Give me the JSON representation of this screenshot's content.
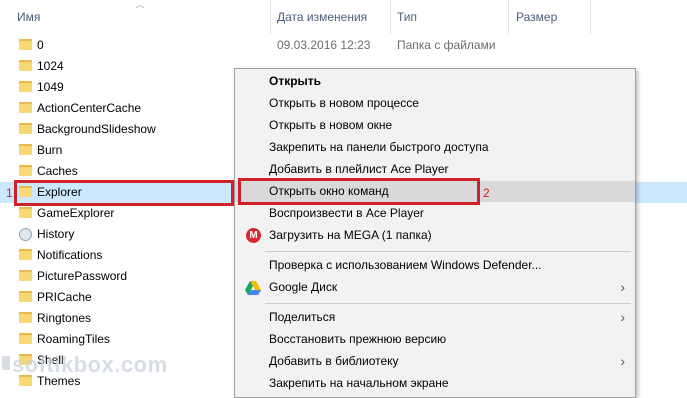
{
  "header": {
    "name": "Имя",
    "date": "Дата изменения",
    "type": "Тип",
    "size": "Размер"
  },
  "rows": [
    {
      "name": "0",
      "date": "09.03.2016 12:23",
      "type": "Папка с файлами"
    },
    {
      "name": "1024",
      "date": "",
      "type": ""
    },
    {
      "name": "1049",
      "date": "",
      "type": ""
    },
    {
      "name": "ActionCenterCache",
      "date": "",
      "type": ""
    },
    {
      "name": "BackgroundSlideshow",
      "date": "",
      "type": ""
    },
    {
      "name": "Burn",
      "date": "",
      "type": ""
    },
    {
      "name": "Caches",
      "date": "",
      "type": ""
    },
    {
      "name": "Explorer",
      "date": "",
      "type": ""
    },
    {
      "name": "GameExplorer",
      "date": "",
      "type": ""
    },
    {
      "name": "History",
      "date": "",
      "type": ""
    },
    {
      "name": "Notifications",
      "date": "",
      "type": ""
    },
    {
      "name": "PicturePassword",
      "date": "",
      "type": ""
    },
    {
      "name": "PRICache",
      "date": "",
      "type": ""
    },
    {
      "name": "Ringtones",
      "date": "",
      "type": ""
    },
    {
      "name": "RoamingTiles",
      "date": "",
      "type": ""
    },
    {
      "name": "Shell",
      "date": "",
      "type": ""
    },
    {
      "name": "Themes",
      "date": "",
      "type": ""
    }
  ],
  "annotations": {
    "one": "1",
    "two": "2",
    "color": "#d0212b"
  },
  "menu": {
    "open": "Открыть",
    "open_new_process": "Открыть в новом процессе",
    "open_new_window": "Открыть в новом окне",
    "pin_quick_access": "Закрепить на панели быстрого доступа",
    "add_ace_playlist": "Добавить в плейлист Ace Player",
    "open_cmd_window": "Открыть окно команд",
    "play_ace": "Воспроизвести в Ace Player",
    "upload_mega": "Загрузить на MEGA (1 папка)",
    "defender_scan": "Проверка с использованием Windows Defender...",
    "google_drive": "Google Диск",
    "share": "Поделиться",
    "restore_version": "Восстановить прежнюю версию",
    "add_library": "Добавить в библиотеку",
    "pin_start": "Закрепить на начальном экране"
  },
  "watermark": "softikbox.com",
  "colors": {
    "selection": "#cce8ff",
    "menu_bg": "#f2f2f2",
    "folder": "#f8d775",
    "header_text": "#4c607a"
  }
}
